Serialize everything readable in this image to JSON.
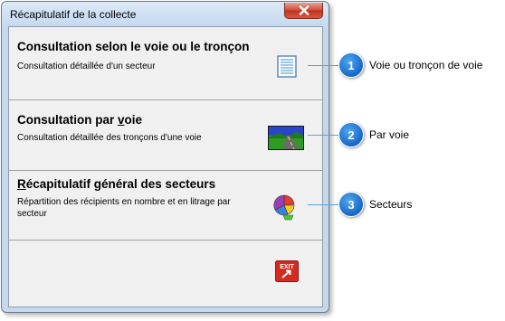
{
  "window": {
    "title": "Récapitulatif de la collecte"
  },
  "items": [
    {
      "heading": "Consultation selon le voie ou le tronçon",
      "description": "Consultation détaillée d'un secteur",
      "icon": "document-list-icon"
    },
    {
      "heading_prefix": "Consultation par ",
      "heading_underlined": "v",
      "heading_suffix": "oie",
      "description": "Consultation détaillée des tronçons d'une voie",
      "icon": "road-landscape-icon"
    },
    {
      "heading_underlined": "R",
      "heading_suffix": "écapitulatif général des secteurs",
      "description": "Répartition des récipients en nombre et en litrage par secteur",
      "icon": "pie-chart-icon"
    }
  ],
  "exit": {
    "icon_text": "EXIT"
  },
  "callouts": [
    {
      "number": "1",
      "label": "Voie ou tronçon de voie"
    },
    {
      "number": "2",
      "label": "Par voie"
    },
    {
      "number": "3",
      "label": "Secteurs"
    }
  ],
  "colors": {
    "accent": "#1f74d0",
    "callout_line": "#55a4d8",
    "close_button": "#c83e26"
  }
}
